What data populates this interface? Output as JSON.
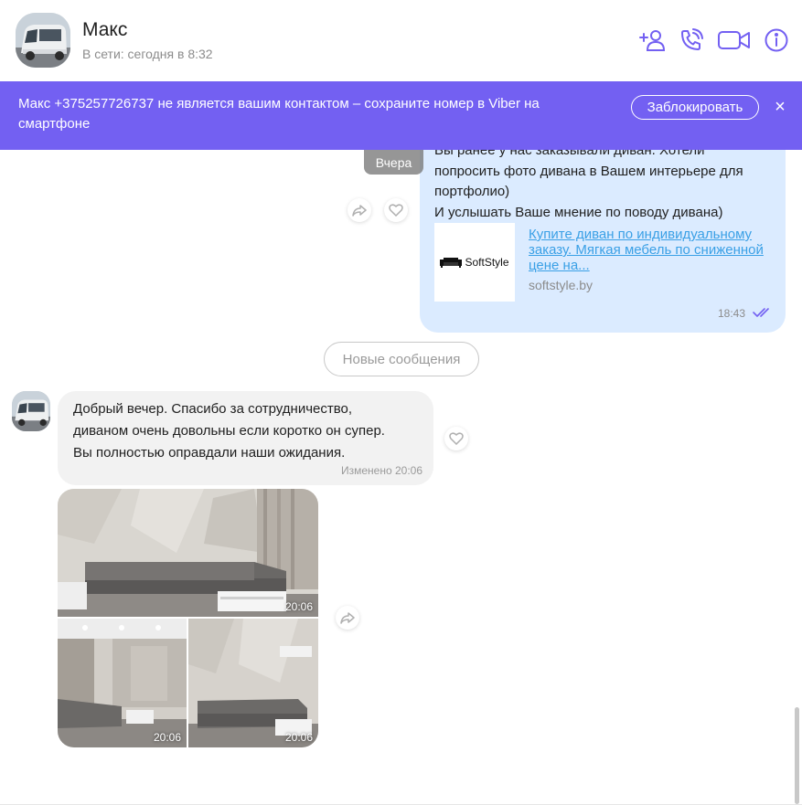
{
  "contact": {
    "name": "Макс",
    "status": "В сети: сегодня в 8:32"
  },
  "header_icons": [
    "add-contact-icon",
    "voice-call-icon",
    "video-call-icon",
    "info-icon"
  ],
  "banner": {
    "text": "Макс +375257726737 не является вашим контактом – сохраните номер в Viber на смартфоне",
    "block_label": "Заблокировать",
    "close_glyph": "×"
  },
  "date_chip": "Вчера",
  "outgoing": {
    "text": "Вы ранее у нас заказывали диван. Хотели\nпопросить фото дивана в Вашем интерьере для\nпортфолио)\nИ услышать Ваше мнение по поводу дивана)",
    "link_preview": {
      "logo_text": "SoftStyle",
      "title": "Купите диван по индивидуальному заказу. Мягкая мебель по сниженной цене на...",
      "domain": "softstyle.by"
    },
    "time": "18:43",
    "status": "read"
  },
  "new_messages_label": "Новые сообщения",
  "incoming": {
    "text": "Добрый вечер. Спасибо за сотрудничество,\nдиваном очень довольны если коротко он супер.\nВы полностью оправдали наши ожидания.",
    "time": "Изменено 20:06"
  },
  "photos": [
    {
      "time": "20:06"
    },
    {
      "time": "20:06"
    },
    {
      "time": "20:06"
    }
  ],
  "colors": {
    "accent": "#7360f2",
    "outgoing_bubble": "#dbebff",
    "incoming_bubble": "#f2f2f2",
    "link": "#3aa0e6"
  }
}
